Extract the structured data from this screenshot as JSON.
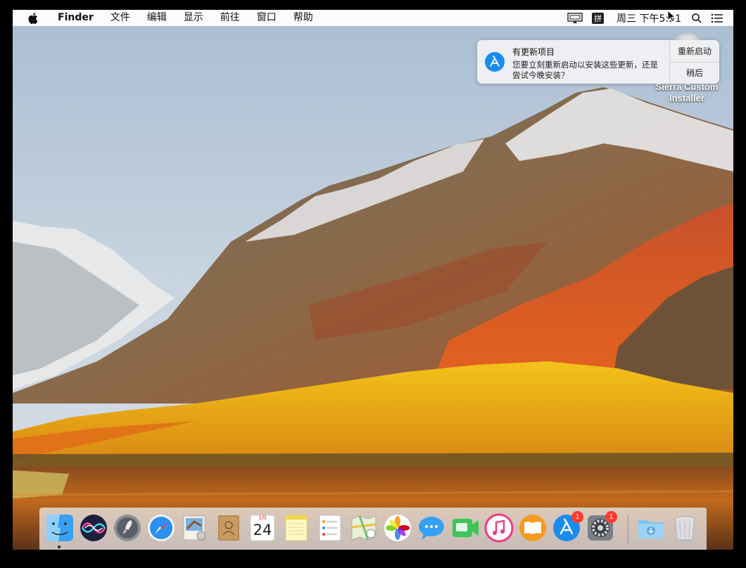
{
  "menubar": {
    "app_name": "Finder",
    "menus": [
      "文件",
      "编辑",
      "显示",
      "前往",
      "窗口",
      "帮助"
    ],
    "ime_label": "拼",
    "clock": "周三 下午5:31"
  },
  "notification": {
    "title": "有更新项目",
    "message": "您要立刻重新启动以安装这些更新，还是尝试今晚安装？",
    "primary_button": "重新启动",
    "secondary_button": "稍后"
  },
  "desktop": {
    "icon_label": "Sierra Custom Installer"
  },
  "dock": {
    "items": [
      {
        "name": "finder-icon",
        "running": true
      },
      {
        "name": "siri-icon"
      },
      {
        "name": "launchpad-icon"
      },
      {
        "name": "safari-icon"
      },
      {
        "name": "mail-icon"
      },
      {
        "name": "contacts-icon"
      },
      {
        "name": "calendar-icon",
        "month": "3月",
        "day": "24"
      },
      {
        "name": "notes-icon"
      },
      {
        "name": "reminders-icon"
      },
      {
        "name": "maps-icon"
      },
      {
        "name": "photos-icon"
      },
      {
        "name": "messages-icon"
      },
      {
        "name": "facetime-icon"
      },
      {
        "name": "itunes-icon"
      },
      {
        "name": "ibooks-icon"
      },
      {
        "name": "app-store-icon",
        "badge": "1"
      },
      {
        "name": "system-preferences-icon",
        "badge": "1"
      },
      {
        "name": "downloads-folder-icon"
      },
      {
        "name": "trash-icon"
      }
    ]
  },
  "colors": {
    "menubar": "#f4f4f4",
    "badge": "#ff3b30",
    "app_store_blue": "#1a8cf0"
  }
}
